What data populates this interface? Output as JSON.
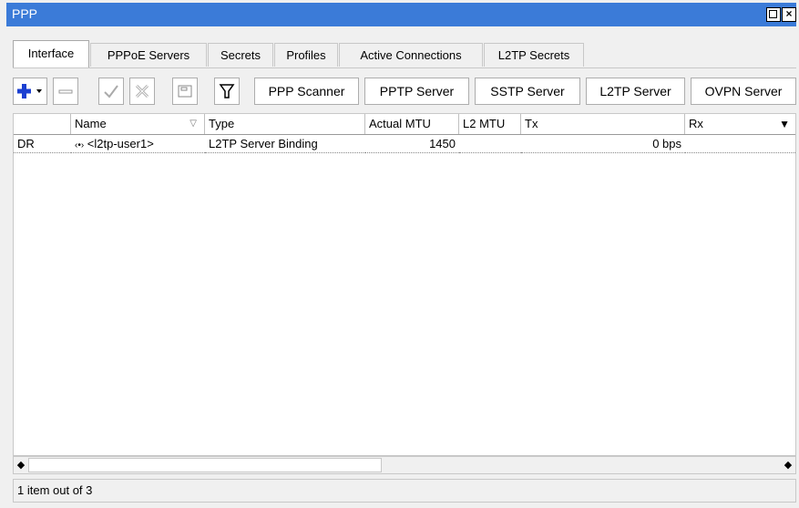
{
  "window": {
    "title": "PPP"
  },
  "tabs": [
    {
      "label": "Interface"
    },
    {
      "label": "PPPoE Servers"
    },
    {
      "label": "Secrets"
    },
    {
      "label": "Profiles"
    },
    {
      "label": "Active Connections"
    },
    {
      "label": "L2TP Secrets"
    }
  ],
  "toolbar": {
    "icons": [
      "add-icon",
      "remove-icon",
      "enable-icon",
      "disable-icon",
      "comment-icon",
      "filter-icon"
    ],
    "buttons": [
      {
        "label": "PPP Scanner"
      },
      {
        "label": "PPTP Server"
      },
      {
        "label": "SSTP Server"
      },
      {
        "label": "L2TP Server"
      },
      {
        "label": "OVPN Server"
      }
    ]
  },
  "table": {
    "columns": [
      "",
      "Name",
      "Type",
      "Actual MTU",
      "L2 MTU",
      "Tx",
      "Rx"
    ],
    "rows": [
      {
        "flags": "DR",
        "name": "<l2tp-user1>",
        "type": "L2TP Server Binding",
        "actual_mtu": "1450",
        "l2_mtu": "",
        "tx": "0 bps",
        "rx": ""
      }
    ]
  },
  "status": {
    "text": "1 item out of 3"
  },
  "colors": {
    "titlebar": "#3b7bd8",
    "add_icon": "#1b3fd1"
  }
}
